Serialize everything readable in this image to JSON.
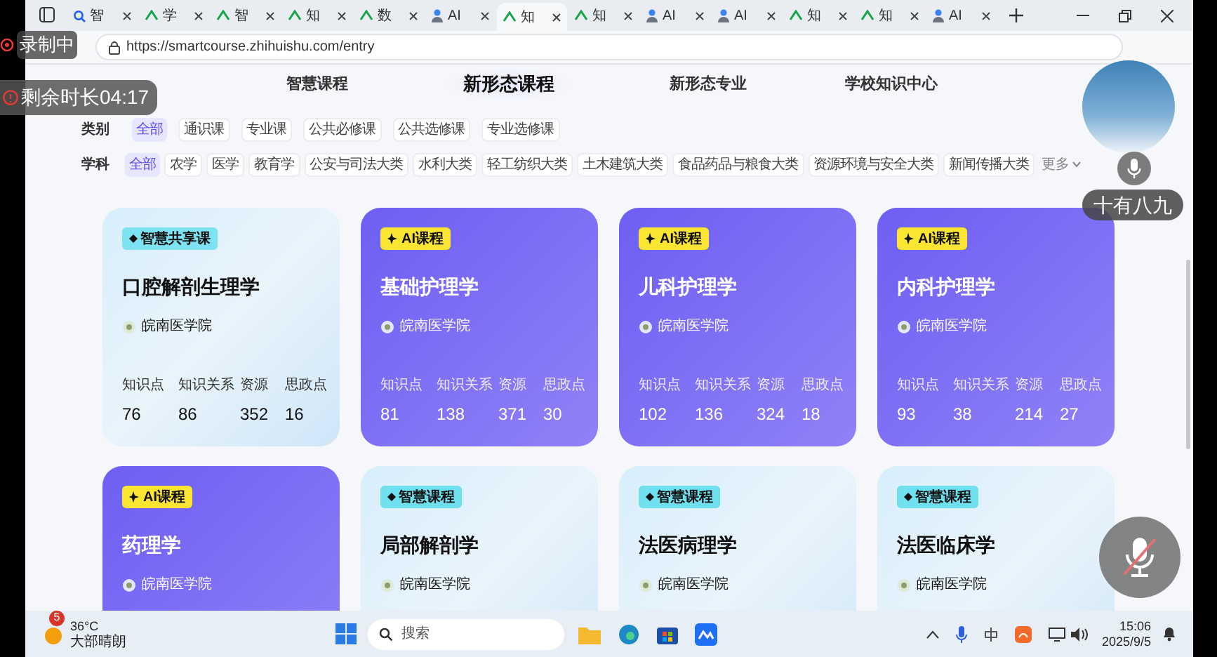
{
  "browser": {
    "tabs": [
      {
        "label": "智",
        "kind": "search",
        "selected": false
      },
      {
        "label": "学",
        "kind": "site",
        "selected": false
      },
      {
        "label": "智",
        "kind": "site",
        "selected": false
      },
      {
        "label": "知",
        "kind": "site",
        "selected": false
      },
      {
        "label": "数",
        "kind": "site",
        "selected": false
      },
      {
        "label": "AI",
        "kind": "agent",
        "selected": false
      },
      {
        "label": "知",
        "kind": "site",
        "selected": true
      },
      {
        "label": "知",
        "kind": "site",
        "selected": false
      },
      {
        "label": "AI",
        "kind": "agent",
        "selected": false
      },
      {
        "label": "AI",
        "kind": "agent",
        "selected": false
      },
      {
        "label": "知",
        "kind": "site",
        "selected": false
      },
      {
        "label": "知",
        "kind": "site",
        "selected": false
      },
      {
        "label": "AI",
        "kind": "agent",
        "selected": false
      }
    ],
    "url": "https://smartcourse.zhihuishu.com/entry"
  },
  "overlays": {
    "recording": "录制中",
    "timer": "剩余时长04:17",
    "speaker_name": "十有八九",
    "muted": true
  },
  "nav": [
    {
      "label": "智慧课程",
      "selected": false
    },
    {
      "label": "新形态课程",
      "selected": true
    },
    {
      "label": "新形态专业",
      "selected": false
    },
    {
      "label": "学校知识中心",
      "selected": false
    }
  ],
  "filters": [
    {
      "label": "类别",
      "options": [
        {
          "label": "全部",
          "selected": true
        },
        {
          "label": "通识课",
          "selected": false
        },
        {
          "label": "专业课",
          "selected": false
        },
        {
          "label": "公共必修课",
          "selected": false
        },
        {
          "label": "公共选修课",
          "selected": false
        },
        {
          "label": "专业选修课",
          "selected": false
        }
      ]
    },
    {
      "label": "学科",
      "options": [
        {
          "label": "全部",
          "selected": true
        },
        {
          "label": "农学",
          "selected": false
        },
        {
          "label": "医学",
          "selected": false
        },
        {
          "label": "教育学",
          "selected": false
        },
        {
          "label": "公安与司法大类",
          "selected": false
        },
        {
          "label": "水利大类",
          "selected": false
        },
        {
          "label": "轻工纺织大类",
          "selected": false
        },
        {
          "label": "土木建筑大类",
          "selected": false
        },
        {
          "label": "食品药品与粮食大类",
          "selected": false
        },
        {
          "label": "资源环境与安全大类",
          "selected": false
        },
        {
          "label": "新闻传播大类",
          "selected": false
        }
      ],
      "more": "更多"
    }
  ],
  "courses": [
    {
      "kind": "smart",
      "badge": "智慧共享课",
      "title": "口腔解剖生理学",
      "school": "皖南医学院",
      "stats": [
        {
          "label": "知识点",
          "value": "76"
        },
        {
          "label": "知识关系",
          "value": "86"
        },
        {
          "label": "资源",
          "value": "352"
        },
        {
          "label": "思政点",
          "value": "16"
        }
      ]
    },
    {
      "kind": "ai",
      "badge": "AI课程",
      "title": "基础护理学",
      "school": "皖南医学院",
      "stats": [
        {
          "label": "知识点",
          "value": "81"
        },
        {
          "label": "知识关系",
          "value": "138"
        },
        {
          "label": "资源",
          "value": "371"
        },
        {
          "label": "思政点",
          "value": "30"
        }
      ]
    },
    {
      "kind": "ai",
      "badge": "AI课程",
      "title": "儿科护理学",
      "school": "皖南医学院",
      "stats": [
        {
          "label": "知识点",
          "value": "102"
        },
        {
          "label": "知识关系",
          "value": "136"
        },
        {
          "label": "资源",
          "value": "324"
        },
        {
          "label": "思政点",
          "value": "18"
        }
      ]
    },
    {
      "kind": "ai",
      "badge": "AI课程",
      "title": "内科护理学",
      "school": "皖南医学院",
      "stats": [
        {
          "label": "知识点",
          "value": "93"
        },
        {
          "label": "知识关系",
          "value": "38"
        },
        {
          "label": "资源",
          "value": "214"
        },
        {
          "label": "思政点",
          "value": "27"
        }
      ]
    },
    {
      "kind": "ai",
      "badge": "AI课程",
      "title": "药理学",
      "school": "皖南医学院"
    },
    {
      "kind": "smart",
      "badge": "智慧课程",
      "title": "局部解剖学",
      "school": "皖南医学院"
    },
    {
      "kind": "smart",
      "badge": "智慧课程",
      "title": "法医病理学",
      "school": "皖南医学院"
    },
    {
      "kind": "smart",
      "badge": "智慧课程",
      "title": "法医临床学",
      "school": "皖南医学院"
    }
  ],
  "taskbar": {
    "temperature": "36°C",
    "weather": "大部晴朗",
    "notification_count": "5",
    "search_placeholder": "搜索",
    "time": "15:06",
    "date": "2025/9/5"
  }
}
